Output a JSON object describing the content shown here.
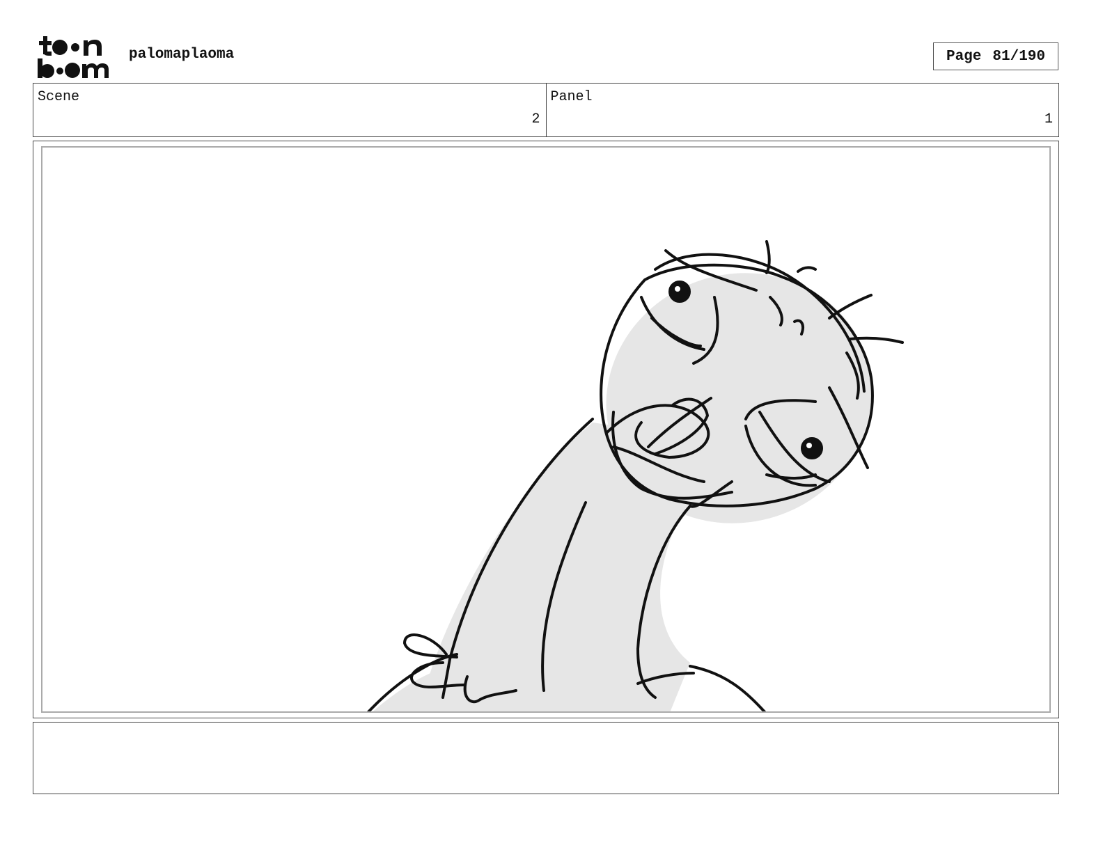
{
  "header": {
    "logo_text": "toon boom",
    "project_name": "palomaplaoma",
    "page_label": "Page",
    "page_number": "81/190"
  },
  "scene": {
    "label": "Scene",
    "value": "2"
  },
  "panel": {
    "label": "Panel",
    "value": "1"
  },
  "panel_image": {
    "icon": "storyboard-sketch-character"
  },
  "notes": {
    "text": ""
  }
}
